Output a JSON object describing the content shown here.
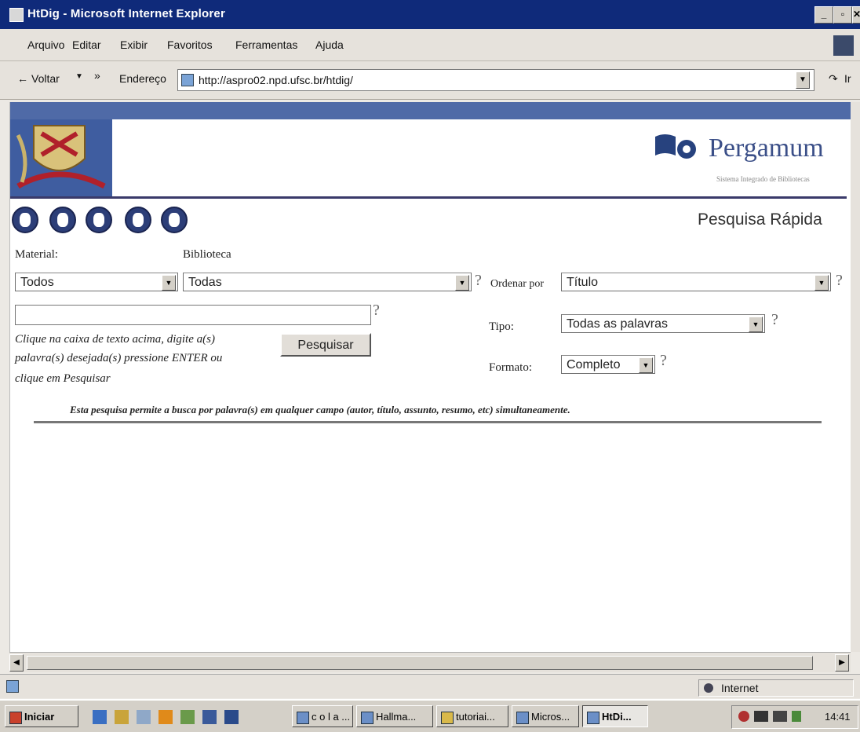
{
  "window": {
    "title": "HtDig - Microsoft Internet Explorer",
    "controls": [
      "_",
      "▫",
      "✕"
    ]
  },
  "menu": {
    "items": [
      "Arquivo",
      "Editar",
      "Exibir",
      "Favoritos",
      "Ferramentas",
      "Ajuda"
    ]
  },
  "toolbar": {
    "back_label": "Voltar",
    "more": "»",
    "address_label": "Endereço",
    "go_label": "Ir"
  },
  "address": {
    "url": "http://aspro02.npd.ufsc.br/htdig/"
  },
  "page": {
    "brand": "Pergamum",
    "brand_sub": "Sistema Integrado de Bibliotecas",
    "heading": "Pesquisa Rápida",
    "material_label": "Material:",
    "material_value": "Todos",
    "biblioteca_label": "Biblioteca",
    "biblioteca_value": "Todas",
    "ordenar_label": "Ordenar por",
    "ordenar_value": "Título",
    "search_value": "",
    "instructions": [
      "Clique na caixa de texto acima, digite a(s)",
      "palavra(s) desejada(s) pressione ENTER ou",
      "clique em Pesquisar"
    ],
    "search_button": "Pesquisar",
    "tipo_label": "Tipo:",
    "tipo_value": "Todas as palavras",
    "formato_label": "Formato:",
    "formato_value": "Completo",
    "help": "?",
    "footer_note": "Esta pesquisa permite a busca por palavra(s) em qualquer campo (autor, título, assunto, resumo, etc) simultaneamente."
  },
  "status": {
    "zone": "Internet"
  },
  "taskbar": {
    "start": "Iniciar",
    "buttons": [
      "c o l a ...",
      "Hallma...",
      "tutoriai...",
      "Micros...",
      "HtDi..."
    ],
    "clock": "14:41"
  },
  "colors": {
    "titlebar": "#0f2a7a",
    "page_bar": "#4f6aa7",
    "nav_buttons": "#2c3e78"
  }
}
